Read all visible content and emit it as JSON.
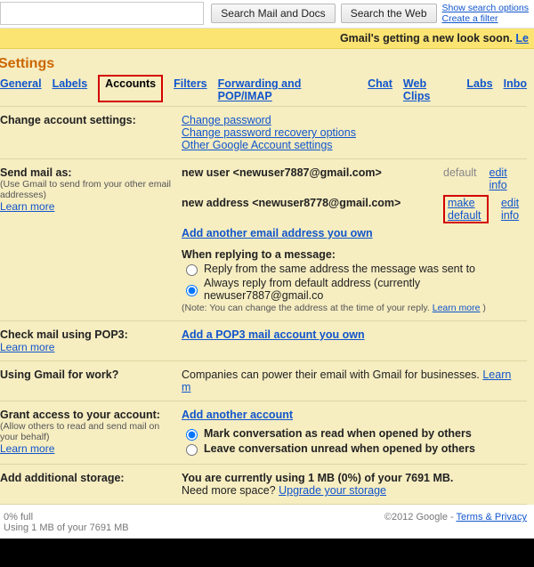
{
  "search": {
    "placeholder": "",
    "btn_mail_docs": "Search Mail and Docs",
    "btn_web": "Search the Web",
    "show_options": "Show search options",
    "create_filter": "Create a filter"
  },
  "banner": {
    "text": "Gmail's getting a new look soon.  ",
    "learn": "Le"
  },
  "settings": {
    "title": "Settings",
    "tabs": {
      "general": "General",
      "labels": "Labels",
      "accounts": "Accounts",
      "filters": "Filters",
      "forwarding": "Forwarding and POP/IMAP",
      "chat": "Chat",
      "webclips": "Web Clips",
      "labs": "Labs",
      "inbox": "Inbo"
    }
  },
  "change_account": {
    "label": "Change account settings:",
    "change_pw": "Change password",
    "change_recovery": "Change password recovery options",
    "other_settings": "Other Google Account settings"
  },
  "send_as": {
    "label": "Send mail as:",
    "sub": "(Use Gmail to send from your other email addresses)",
    "learn": "Learn more",
    "addr1": "new user <newuser7887@gmail.com>",
    "addr1_status": "default",
    "addr1_edit": "edit info",
    "addr2": "new address <newuser8778@gmail.com>",
    "addr2_make_default": "make default",
    "addr2_edit": "edit info",
    "add_another": "Add another email address you own",
    "reply_heading": "When replying to a message:",
    "reply_opt1": "Reply from the same address the message was sent to",
    "reply_opt2": "Always reply from default address (currently newuser7887@gmail.co",
    "reply_note_prefix": "(Note: You can change the address at the time of your reply. ",
    "reply_note_link": "Learn more",
    "reply_note_suffix": ")"
  },
  "pop3": {
    "label": "Check mail using POP3:",
    "learn": "Learn more",
    "link": "Add a POP3 mail account you own"
  },
  "work": {
    "label": "Using Gmail for work?",
    "text": "Companies can power their email with Gmail for businesses. ",
    "learn": "Learn m"
  },
  "grant": {
    "label": "Grant access to your account:",
    "sub": "(Allow others to read and send mail on your behalf)",
    "learn": "Learn more",
    "add": "Add another account",
    "opt1": "Mark conversation as read when opened by others",
    "opt2": "Leave conversation unread when opened by others"
  },
  "storage": {
    "label": "Add additional storage:",
    "text1": "You are currently using 1 MB (0%) of your 7691 MB.",
    "text2": "Need more space? ",
    "upgrade": "Upgrade your storage"
  },
  "footer": {
    "pct": "0% full",
    "line2": "Using 1 MB of your 7691 MB",
    "copyright": "©2012 Google - ",
    "terms": "Terms & Privacy"
  }
}
